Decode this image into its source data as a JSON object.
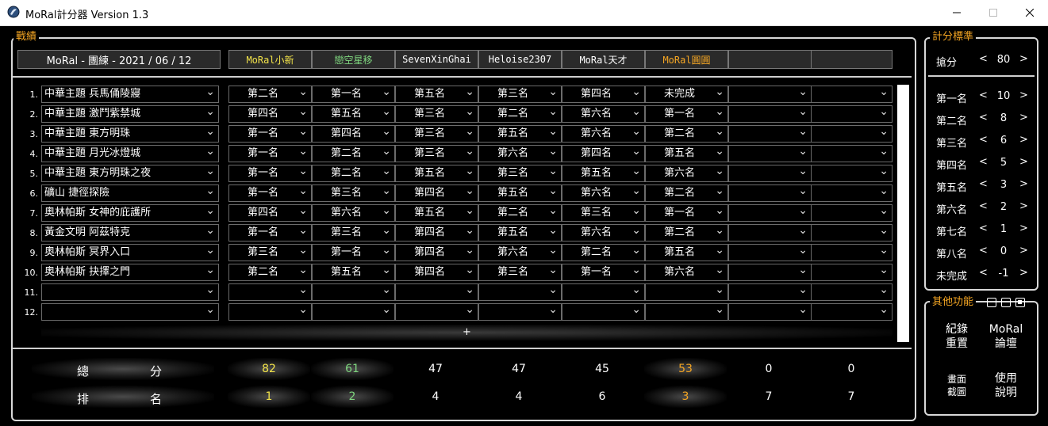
{
  "window": {
    "title": "MoRal計分器 Version 1.3"
  },
  "panels": {
    "record": "戰績",
    "standard": "計分標準",
    "other": "其他功能"
  },
  "header": {
    "event": "MoRal - 團練 - 2021 / 06 / 12",
    "players": [
      {
        "name": "MoRal小新",
        "color": "#f2e34a"
      },
      {
        "name": "戀空星移",
        "color": "#7fd67f"
      },
      {
        "name": "SevenXinGhai",
        "color": "#ffffff"
      },
      {
        "name": "Heloise2307",
        "color": "#ffffff"
      },
      {
        "name": "MoRal天才",
        "color": "#ffffff"
      },
      {
        "name": "MoRal圓圓",
        "color": "#f5a623"
      },
      {
        "name": "",
        "color": "#ffffff"
      },
      {
        "name": "",
        "color": "#ffffff"
      }
    ]
  },
  "rows": [
    {
      "num": "1.",
      "map": "中華主題 兵馬俑陵寢",
      "ranks": [
        "第二名",
        "第一名",
        "第五名",
        "第三名",
        "第四名",
        "未完成",
        "",
        ""
      ]
    },
    {
      "num": "2.",
      "map": "中華主題 激鬥紫禁城",
      "ranks": [
        "第四名",
        "第五名",
        "第三名",
        "第二名",
        "第六名",
        "第一名",
        "",
        ""
      ]
    },
    {
      "num": "3.",
      "map": "中華主題 東方明珠",
      "ranks": [
        "第一名",
        "第四名",
        "第三名",
        "第五名",
        "第六名",
        "第二名",
        "",
        ""
      ]
    },
    {
      "num": "4.",
      "map": "中華主題 月光冰燈城",
      "ranks": [
        "第一名",
        "第二名",
        "第三名",
        "第六名",
        "第四名",
        "第五名",
        "",
        ""
      ]
    },
    {
      "num": "5.",
      "map": "中華主題 東方明珠之夜",
      "ranks": [
        "第一名",
        "第二名",
        "第五名",
        "第三名",
        "第五名",
        "第六名",
        "",
        ""
      ]
    },
    {
      "num": "6.",
      "map": "礦山 捷徑探險",
      "ranks": [
        "第一名",
        "第三名",
        "第四名",
        "第五名",
        "第六名",
        "第二名",
        "",
        ""
      ]
    },
    {
      "num": "7.",
      "map": "奧林帕斯 女神的庇護所",
      "ranks": [
        "第四名",
        "第六名",
        "第五名",
        "第二名",
        "第三名",
        "第一名",
        "",
        ""
      ]
    },
    {
      "num": "8.",
      "map": "黃金文明 阿茲特克",
      "ranks": [
        "第一名",
        "第三名",
        "第四名",
        "第五名",
        "第六名",
        "第二名",
        "",
        ""
      ]
    },
    {
      "num": "9.",
      "map": "奧林帕斯 冥界入口",
      "ranks": [
        "第三名",
        "第一名",
        "第四名",
        "第六名",
        "第二名",
        "第五名",
        "",
        ""
      ]
    },
    {
      "num": "10.",
      "map": "奧林帕斯 抉擇之門",
      "ranks": [
        "第二名",
        "第五名",
        "第四名",
        "第三名",
        "第一名",
        "第六名",
        "",
        ""
      ]
    },
    {
      "num": "11.",
      "map": "",
      "ranks": [
        "",
        "",
        "",
        "",
        "",
        "",
        "",
        ""
      ]
    },
    {
      "num": "12.",
      "map": "",
      "ranks": [
        "",
        "",
        "",
        "",
        "",
        "",
        "",
        ""
      ]
    }
  ],
  "add_label": "+",
  "summary": {
    "total_label": [
      "總",
      "分"
    ],
    "rank_label": [
      "排",
      "名"
    ],
    "totals": [
      "82",
      "61",
      "47",
      "47",
      "45",
      "53",
      "0",
      "0"
    ],
    "ranks": [
      "1",
      "2",
      "4",
      "4",
      "6",
      "3",
      "7",
      "7"
    ]
  },
  "standard": {
    "steal": {
      "label": "搶分",
      "value": "80"
    },
    "items": [
      {
        "label": "第一名",
        "value": "10"
      },
      {
        "label": "第二名",
        "value": "8"
      },
      {
        "label": "第三名",
        "value": "6"
      },
      {
        "label": "第四名",
        "value": "5"
      },
      {
        "label": "第五名",
        "value": "3"
      },
      {
        "label": "第六名",
        "value": "2"
      },
      {
        "label": "第七名",
        "value": "1"
      },
      {
        "label": "第八名",
        "value": "0"
      },
      {
        "label": "未完成",
        "value": "-1"
      }
    ],
    "dec": "<",
    "inc": ">"
  },
  "functions": {
    "reset": [
      "紀錄",
      "重置"
    ],
    "forum": [
      "MoRal",
      "論壇"
    ],
    "screenshot": [
      "畫面",
      "截圖"
    ],
    "help": [
      "使用",
      "說明"
    ]
  }
}
